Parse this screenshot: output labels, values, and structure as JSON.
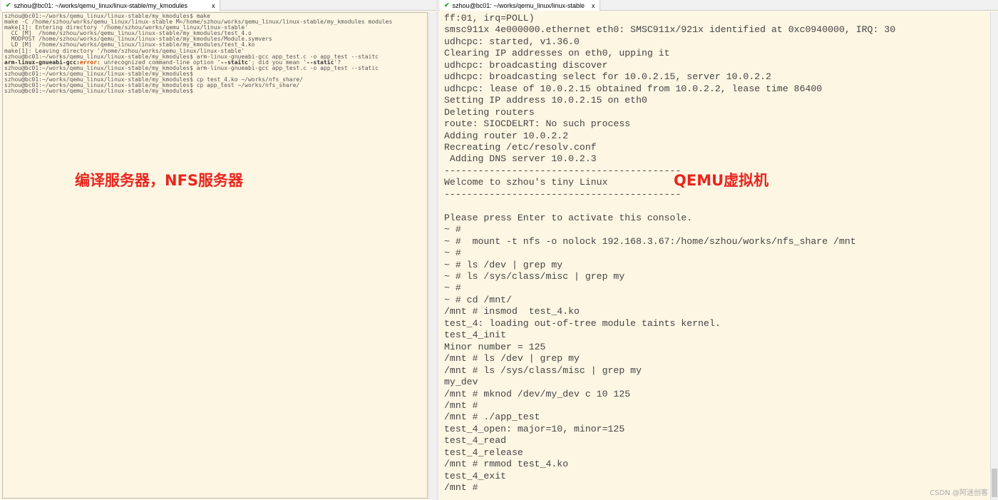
{
  "left": {
    "tab_title": "szhou@bc01: ~/works/qemu_linux/linux-stable/my_kmodules",
    "close": "x",
    "lines": [
      "szhou@bc01:~/works/qemu_linux/linux-stable/my_kmodules$ make",
      "make -C /home/szhou/works/qemu_linux/linux-stable M=/home/szhou/works/qemu_linux/linux-stable/my_kmodules modules",
      "make[1]: Entering directory '/home/szhou/works/qemu_linux/linux-stable'",
      "  CC [M]  /home/szhou/works/qemu_linux/linux-stable/my_kmodules/test_4.o",
      "  MODPOST /home/szhou/works/qemu_linux/linux-stable/my_kmodules/Module.symvers",
      "  LD [M]  /home/szhou/works/qemu_linux/linux-stable/my_kmodules/test_4.ko",
      "make[1]: Leaving directory '/home/szhou/works/qemu_linux/linux-stable'",
      "szhou@bc01:~/works/qemu_linux/linux-stable/my_kmodules$ arm-linux-gnueabi-gcc app_test.c -o app_test --staitc"
    ],
    "error_line": {
      "prog": "arm-linux-gnueabi-gcc:",
      "err": "error:",
      "msg1": " unrecognized command-line option '",
      "opt": "--staitc",
      "msg2": "'; did you mean '",
      "sugg": "--static",
      "msg3": "'?"
    },
    "lines2": [
      "szhou@bc01:~/works/qemu_linux/linux-stable/my_kmodules$ arm-linux-gnueabi-gcc app_test.c -o app_test --static",
      "szhou@bc01:~/works/qemu_linux/linux-stable/my_kmodules$",
      "szhou@bc01:~/works/qemu_linux/linux-stable/my_kmodules$ cp test_4.ko ~/works/nfs_share/",
      "szhou@bc01:~/works/qemu_linux/linux-stable/my_kmodules$ cp app_test ~/works/nfs_share/",
      "szhou@bc01:~/works/qemu_linux/linux-stable/my_kmodules$"
    ],
    "annotation": "编译服务器，NFS服务器"
  },
  "right": {
    "tab_title": "szhou@bc01: ~/works/qemu_linux/linux-stable",
    "close": "x",
    "lines": [
      "ff:01, irq=POLL)",
      "smsc911x 4e000000.ethernet eth0: SMSC911x/921x identified at 0xc0940000, IRQ: 30",
      "udhcpc: started, v1.36.0",
      "Clearing IP addresses on eth0, upping it",
      "udhcpc: broadcasting discover",
      "udhcpc: broadcasting select for 10.0.2.15, server 10.0.2.2",
      "udhcpc: lease of 10.0.2.15 obtained from 10.0.2.2, lease time 86400",
      "Setting IP address 10.0.2.15 on eth0",
      "Deleting routers",
      "route: SIOCDELRT: No such process",
      "Adding router 10.0.2.2",
      "Recreating /etc/resolv.conf",
      " Adding DNS server 10.0.2.3",
      "------------------------------------------",
      "Welcome to szhou's tiny Linux",
      "------------------------------------------",
      "",
      "Please press Enter to activate this console.",
      "~ #",
      "~ #  mount -t nfs -o nolock 192.168.3.67:/home/szhou/works/nfs_share /mnt",
      "~ #",
      "~ # ls /dev | grep my",
      "~ # ls /sys/class/misc | grep my",
      "~ #",
      "~ # cd /mnt/",
      "/mnt # insmod  test_4.ko",
      "test_4: loading out-of-tree module taints kernel.",
      "test_4_init",
      "Minor number = 125",
      "/mnt # ls /dev | grep my",
      "/mnt # ls /sys/class/misc | grep my",
      "my_dev",
      "/mnt # mknod /dev/my_dev c 10 125",
      "/mnt #",
      "/mnt # ./app_test",
      "test_4_open: major=10, minor=125",
      "test_4_read",
      "test_4_release",
      "/mnt # rmmod test_4.ko",
      "test_4_exit",
      "/mnt #"
    ],
    "annotation": "QEMU虚拟机"
  },
  "watermark": "CSDN @阿迷创客",
  "colors": {
    "background": "#fdf6e3",
    "annotation": "#e8261e",
    "error": "#d04a00"
  }
}
